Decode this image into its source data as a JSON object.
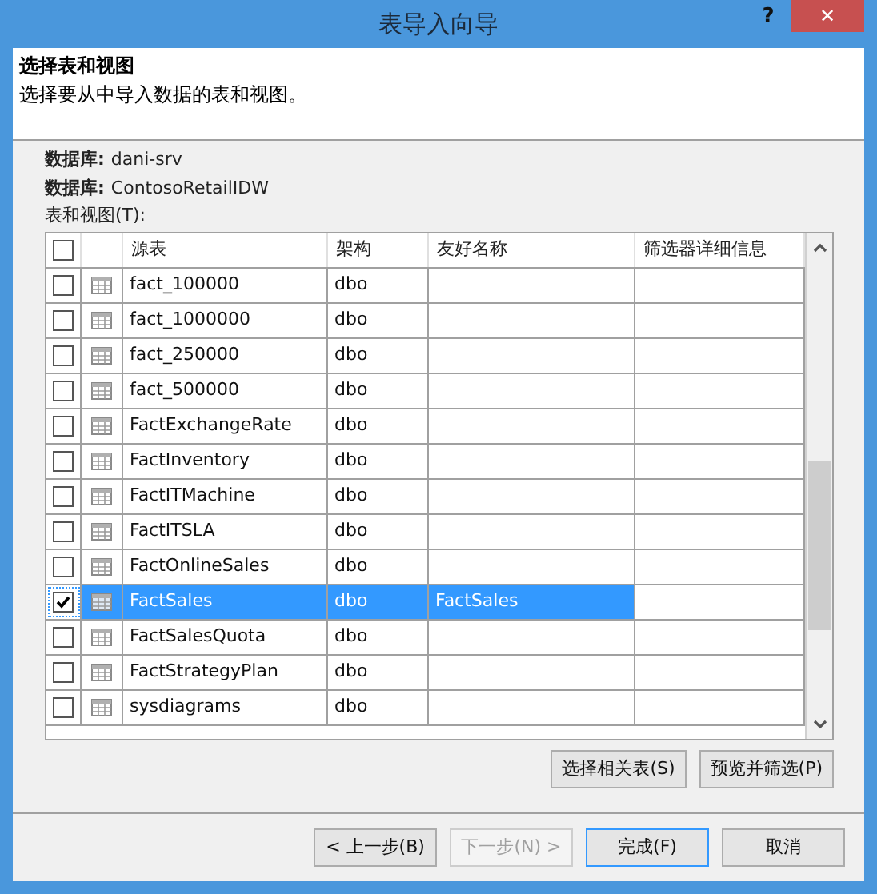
{
  "window": {
    "title": "表导入向导",
    "help": "?",
    "close": "✕"
  },
  "header": {
    "title": "选择表和视图",
    "description": "选择要从中导入数据的表和视图。"
  },
  "info": [
    {
      "label": "数据库:",
      "value": "dani-srv"
    },
    {
      "label": "数据库:",
      "value": "ContosoRetailIDW"
    }
  ],
  "table_label": "表和视图(T):",
  "table": {
    "select_all_checked": false,
    "columns": [
      "源表",
      "架构",
      "友好名称",
      "筛选器详细信息"
    ],
    "rows": [
      {
        "checked": false,
        "selected": false,
        "source": "fact_100000",
        "schema": "dbo",
        "friendly_name": ""
      },
      {
        "checked": false,
        "selected": false,
        "source": "fact_1000000",
        "schema": "dbo",
        "friendly_name": ""
      },
      {
        "checked": false,
        "selected": false,
        "source": "fact_250000",
        "schema": "dbo",
        "friendly_name": ""
      },
      {
        "checked": false,
        "selected": false,
        "source": "fact_500000",
        "schema": "dbo",
        "friendly_name": ""
      },
      {
        "checked": false,
        "selected": false,
        "source": "FactExchangeRate",
        "schema": "dbo",
        "friendly_name": ""
      },
      {
        "checked": false,
        "selected": false,
        "source": "FactInventory",
        "schema": "dbo",
        "friendly_name": ""
      },
      {
        "checked": false,
        "selected": false,
        "source": "FactITMachine",
        "schema": "dbo",
        "friendly_name": ""
      },
      {
        "checked": false,
        "selected": false,
        "source": "FactITSLA",
        "schema": "dbo",
        "friendly_name": ""
      },
      {
        "checked": false,
        "selected": false,
        "source": "FactOnlineSales",
        "schema": "dbo",
        "friendly_name": ""
      },
      {
        "checked": true,
        "selected": true,
        "source": "FactSales",
        "schema": "dbo",
        "friendly_name": "FactSales"
      },
      {
        "checked": false,
        "selected": false,
        "source": "FactSalesQuota",
        "schema": "dbo",
        "friendly_name": ""
      },
      {
        "checked": false,
        "selected": false,
        "source": "FactStrategyPlan",
        "schema": "dbo",
        "friendly_name": ""
      },
      {
        "checked": false,
        "selected": false,
        "source": "sysdiagrams",
        "schema": "dbo",
        "friendly_name": ""
      }
    ]
  },
  "table_buttons": [
    {
      "label": "选择相关表(S)"
    },
    {
      "label": "预览并筛选(P)"
    }
  ],
  "nav_buttons": [
    {
      "label": "< 上一步(B)",
      "disabled": false,
      "default": false
    },
    {
      "label": "下一步(N) >",
      "disabled": true,
      "default": false
    },
    {
      "label": "完成(F)",
      "disabled": false,
      "default": true
    },
    {
      "label": "取消",
      "disabled": false,
      "default": false
    }
  ]
}
